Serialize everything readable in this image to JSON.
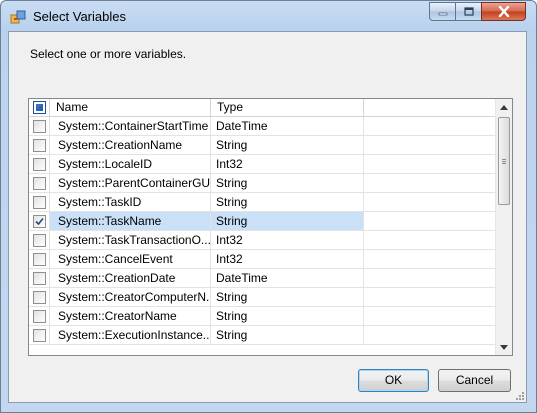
{
  "window": {
    "title": "Select Variables",
    "icon": "variables-dialog-icon",
    "controls": [
      "minimize-icon",
      "maximize-icon",
      "close-icon"
    ]
  },
  "prompt": "Select one or more variables.",
  "grid": {
    "columns": {
      "name": "Name",
      "type": "Type"
    },
    "header_checkbox_state": "indeterminate",
    "rows": [
      {
        "name": "System::ContainerStartTime",
        "type": "DateTime",
        "checked": false
      },
      {
        "name": "System::CreationName",
        "type": "String",
        "checked": false
      },
      {
        "name": "System::LocaleID",
        "type": "Int32",
        "checked": false
      },
      {
        "name": "System::ParentContainerGU...",
        "type": "String",
        "checked": false
      },
      {
        "name": "System::TaskID",
        "type": "String",
        "checked": false
      },
      {
        "name": "System::TaskName",
        "type": "String",
        "checked": true,
        "selected": true
      },
      {
        "name": "System::TaskTransactionO...",
        "type": "Int32",
        "checked": false
      },
      {
        "name": "System::CancelEvent",
        "type": "Int32",
        "checked": false
      },
      {
        "name": "System::CreationDate",
        "type": "DateTime",
        "checked": false
      },
      {
        "name": "System::CreatorComputerN...",
        "type": "String",
        "checked": false
      },
      {
        "name": "System::CreatorName",
        "type": "String",
        "checked": false
      },
      {
        "name": "System::ExecutionInstance...",
        "type": "String",
        "checked": false
      }
    ]
  },
  "buttons": {
    "ok": "OK",
    "cancel": "Cancel"
  },
  "colors": {
    "selection": "#c9e0f7",
    "titlebar": "#b9d1ee",
    "close": "#c2401f"
  }
}
